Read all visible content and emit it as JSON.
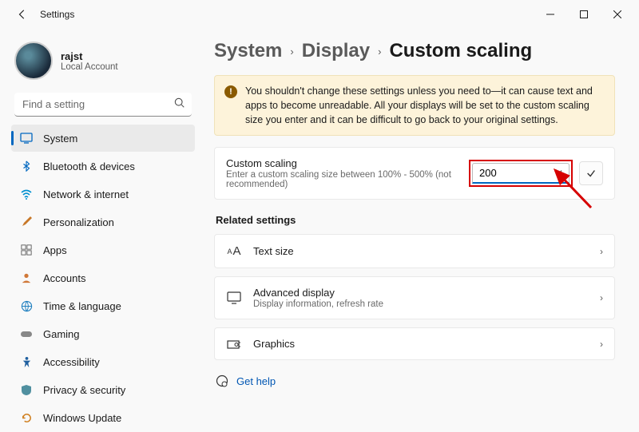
{
  "app_title": "Settings",
  "user": {
    "name": "rajst",
    "subtitle": "Local Account"
  },
  "search": {
    "placeholder": "Find a setting"
  },
  "sidebar": {
    "items": [
      {
        "label": "System"
      },
      {
        "label": "Bluetooth & devices"
      },
      {
        "label": "Network & internet"
      },
      {
        "label": "Personalization"
      },
      {
        "label": "Apps"
      },
      {
        "label": "Accounts"
      },
      {
        "label": "Time & language"
      },
      {
        "label": "Gaming"
      },
      {
        "label": "Accessibility"
      },
      {
        "label": "Privacy & security"
      },
      {
        "label": "Windows Update"
      }
    ]
  },
  "breadcrumb": {
    "a": "System",
    "b": "Display",
    "current": "Custom scaling"
  },
  "warning": "You shouldn't change these settings unless you need to—it can cause text and apps to become unreadable. All your displays will be set to the custom scaling size you enter and it can be difficult to go back to your original settings.",
  "custom_scaling": {
    "title": "Custom scaling",
    "sub": "Enter a custom scaling size between 100% - 500% (not recommended)",
    "value": "200"
  },
  "related_label": "Related settings",
  "related": [
    {
      "title": "Text size",
      "sub": ""
    },
    {
      "title": "Advanced display",
      "sub": "Display information, refresh rate"
    },
    {
      "title": "Graphics",
      "sub": ""
    }
  ],
  "help_label": "Get help"
}
